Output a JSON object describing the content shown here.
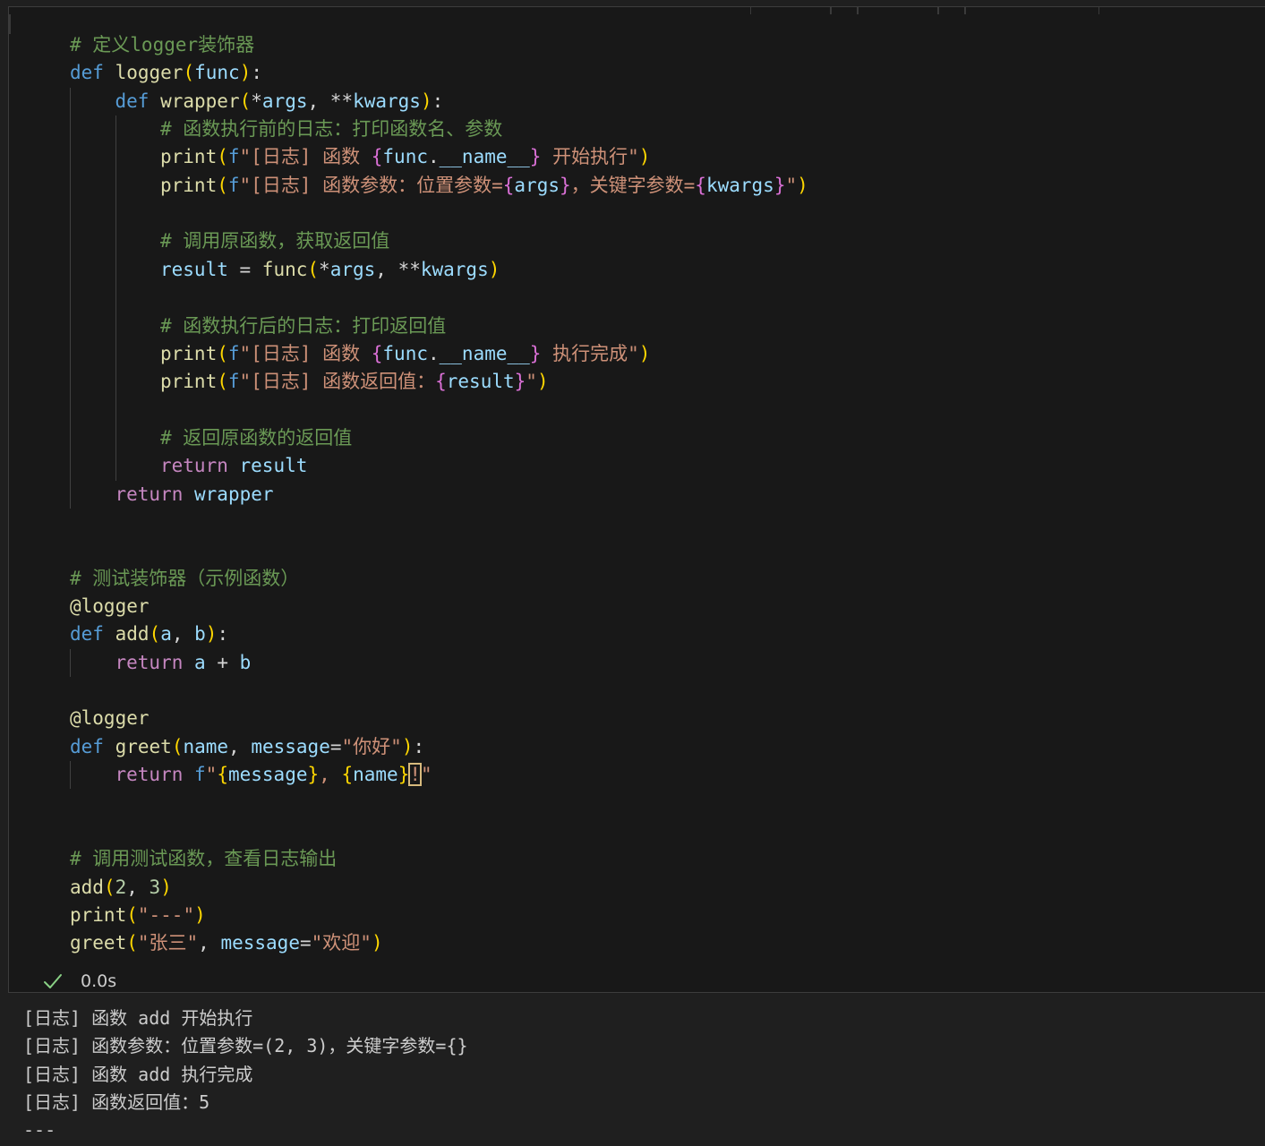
{
  "editor": {
    "lines": [
      {
        "indent": 0,
        "tokens": [
          {
            "t": "# 定义logger装饰器",
            "c": "c"
          }
        ]
      },
      {
        "indent": 0,
        "tokens": [
          {
            "t": "def",
            "c": "k"
          },
          {
            "t": " ",
            "c": "p"
          },
          {
            "t": "logger",
            "c": "f"
          },
          {
            "t": "(",
            "c": "b1"
          },
          {
            "t": "func",
            "c": "v"
          },
          {
            "t": ")",
            "c": "b1"
          },
          {
            "t": ":",
            "c": "p"
          }
        ]
      },
      {
        "indent": 1,
        "tokens": [
          {
            "t": "def",
            "c": "k"
          },
          {
            "t": " ",
            "c": "p"
          },
          {
            "t": "wrapper",
            "c": "f"
          },
          {
            "t": "(",
            "c": "b1"
          },
          {
            "t": "*",
            "c": "op"
          },
          {
            "t": "args",
            "c": "v"
          },
          {
            "t": ", ",
            "c": "p"
          },
          {
            "t": "**",
            "c": "op"
          },
          {
            "t": "kwargs",
            "c": "v"
          },
          {
            "t": ")",
            "c": "b1"
          },
          {
            "t": ":",
            "c": "p"
          }
        ]
      },
      {
        "indent": 2,
        "tokens": [
          {
            "t": "# 函数执行前的日志：打印函数名、参数",
            "c": "c"
          }
        ]
      },
      {
        "indent": 2,
        "tokens": [
          {
            "t": "print",
            "c": "f"
          },
          {
            "t": "(",
            "c": "b1"
          },
          {
            "t": "f",
            "c": "k"
          },
          {
            "t": "\"[日志] 函数 ",
            "c": "s"
          },
          {
            "t": "{",
            "c": "b2"
          },
          {
            "t": "func",
            "c": "v"
          },
          {
            "t": ".",
            "c": "p"
          },
          {
            "t": "__name__",
            "c": "v"
          },
          {
            "t": "}",
            "c": "b2"
          },
          {
            "t": " 开始执行\"",
            "c": "s"
          },
          {
            "t": ")",
            "c": "b1"
          }
        ]
      },
      {
        "indent": 2,
        "tokens": [
          {
            "t": "print",
            "c": "f"
          },
          {
            "t": "(",
            "c": "b1"
          },
          {
            "t": "f",
            "c": "k"
          },
          {
            "t": "\"[日志] 函数参数：位置参数=",
            "c": "s"
          },
          {
            "t": "{",
            "c": "b2"
          },
          {
            "t": "args",
            "c": "v"
          },
          {
            "t": "}",
            "c": "b2"
          },
          {
            "t": "，关键字参数=",
            "c": "s"
          },
          {
            "t": "{",
            "c": "b2"
          },
          {
            "t": "kwargs",
            "c": "v"
          },
          {
            "t": "}",
            "c": "b2"
          },
          {
            "t": "\"",
            "c": "s"
          },
          {
            "t": ")",
            "c": "b1"
          }
        ]
      },
      {
        "indent": 2,
        "tokens": []
      },
      {
        "indent": 2,
        "tokens": [
          {
            "t": "# 调用原函数，获取返回值",
            "c": "c"
          }
        ]
      },
      {
        "indent": 2,
        "tokens": [
          {
            "t": "result",
            "c": "v"
          },
          {
            "t": " = ",
            "c": "op"
          },
          {
            "t": "func",
            "c": "f"
          },
          {
            "t": "(",
            "c": "b1"
          },
          {
            "t": "*",
            "c": "op"
          },
          {
            "t": "args",
            "c": "v"
          },
          {
            "t": ", ",
            "c": "p"
          },
          {
            "t": "**",
            "c": "op"
          },
          {
            "t": "kwargs",
            "c": "v"
          },
          {
            "t": ")",
            "c": "b1"
          }
        ]
      },
      {
        "indent": 2,
        "tokens": []
      },
      {
        "indent": 2,
        "tokens": [
          {
            "t": "# 函数执行后的日志：打印返回值",
            "c": "c"
          }
        ]
      },
      {
        "indent": 2,
        "tokens": [
          {
            "t": "print",
            "c": "f"
          },
          {
            "t": "(",
            "c": "b1"
          },
          {
            "t": "f",
            "c": "k"
          },
          {
            "t": "\"[日志] 函数 ",
            "c": "s"
          },
          {
            "t": "{",
            "c": "b2"
          },
          {
            "t": "func",
            "c": "v"
          },
          {
            "t": ".",
            "c": "p"
          },
          {
            "t": "__name__",
            "c": "v"
          },
          {
            "t": "}",
            "c": "b2"
          },
          {
            "t": " 执行完成\"",
            "c": "s"
          },
          {
            "t": ")",
            "c": "b1"
          }
        ]
      },
      {
        "indent": 2,
        "tokens": [
          {
            "t": "print",
            "c": "f"
          },
          {
            "t": "(",
            "c": "b1"
          },
          {
            "t": "f",
            "c": "k"
          },
          {
            "t": "\"[日志] 函数返回值：",
            "c": "s"
          },
          {
            "t": "{",
            "c": "b2"
          },
          {
            "t": "result",
            "c": "v"
          },
          {
            "t": "}",
            "c": "b2"
          },
          {
            "t": "\"",
            "c": "s"
          },
          {
            "t": ")",
            "c": "b1"
          }
        ]
      },
      {
        "indent": 2,
        "tokens": []
      },
      {
        "indent": 2,
        "tokens": [
          {
            "t": "# 返回原函数的返回值",
            "c": "c"
          }
        ]
      },
      {
        "indent": 2,
        "tokens": [
          {
            "t": "return",
            "c": "r"
          },
          {
            "t": " ",
            "c": "p"
          },
          {
            "t": "result",
            "c": "v"
          }
        ]
      },
      {
        "indent": 1,
        "tokens": [
          {
            "t": "return",
            "c": "r"
          },
          {
            "t": " ",
            "c": "p"
          },
          {
            "t": "wrapper",
            "c": "v"
          }
        ]
      },
      {
        "indent": 0,
        "tokens": []
      },
      {
        "indent": 0,
        "tokens": []
      },
      {
        "indent": 0,
        "tokens": [
          {
            "t": "# 测试装饰器（示例函数）",
            "c": "c"
          }
        ]
      },
      {
        "indent": 0,
        "tokens": [
          {
            "t": "@logger",
            "c": "d"
          }
        ]
      },
      {
        "indent": 0,
        "tokens": [
          {
            "t": "def",
            "c": "k"
          },
          {
            "t": " ",
            "c": "p"
          },
          {
            "t": "add",
            "c": "f"
          },
          {
            "t": "(",
            "c": "b1"
          },
          {
            "t": "a",
            "c": "v"
          },
          {
            "t": ", ",
            "c": "p"
          },
          {
            "t": "b",
            "c": "v"
          },
          {
            "t": ")",
            "c": "b1"
          },
          {
            "t": ":",
            "c": "p"
          }
        ]
      },
      {
        "indent": 1,
        "tokens": [
          {
            "t": "return",
            "c": "r"
          },
          {
            "t": " ",
            "c": "p"
          },
          {
            "t": "a",
            "c": "v"
          },
          {
            "t": " + ",
            "c": "op"
          },
          {
            "t": "b",
            "c": "v"
          }
        ]
      },
      {
        "indent": 0,
        "tokens": []
      },
      {
        "indent": 0,
        "tokens": [
          {
            "t": "@logger",
            "c": "d"
          }
        ]
      },
      {
        "indent": 0,
        "tokens": [
          {
            "t": "def",
            "c": "k"
          },
          {
            "t": " ",
            "c": "p"
          },
          {
            "t": "greet",
            "c": "f"
          },
          {
            "t": "(",
            "c": "b1"
          },
          {
            "t": "name",
            "c": "v"
          },
          {
            "t": ", ",
            "c": "p"
          },
          {
            "t": "message",
            "c": "v"
          },
          {
            "t": "=",
            "c": "op"
          },
          {
            "t": "\"你好\"",
            "c": "s"
          },
          {
            "t": ")",
            "c": "b1"
          },
          {
            "t": ":",
            "c": "p"
          }
        ]
      },
      {
        "indent": 1,
        "tokens": [
          {
            "t": "return",
            "c": "r"
          },
          {
            "t": " ",
            "c": "p"
          },
          {
            "t": "f",
            "c": "k"
          },
          {
            "t": "\"",
            "c": "s"
          },
          {
            "t": "{",
            "c": "b1"
          },
          {
            "t": "message",
            "c": "v"
          },
          {
            "t": "}",
            "c": "b1"
          },
          {
            "t": ", ",
            "c": "s"
          },
          {
            "t": "{",
            "c": "b1"
          },
          {
            "t": "name",
            "c": "v"
          },
          {
            "t": "}",
            "c": "b1"
          },
          {
            "t": "!",
            "c": "cur"
          },
          {
            "t": "\"",
            "c": "s"
          }
        ]
      },
      {
        "indent": 0,
        "tokens": []
      },
      {
        "indent": 0,
        "tokens": []
      },
      {
        "indent": 0,
        "tokens": [
          {
            "t": "# 调用测试函数，查看日志输出",
            "c": "c"
          }
        ]
      },
      {
        "indent": 0,
        "tokens": [
          {
            "t": "add",
            "c": "f"
          },
          {
            "t": "(",
            "c": "b1"
          },
          {
            "t": "2",
            "c": "n"
          },
          {
            "t": ", ",
            "c": "p"
          },
          {
            "t": "3",
            "c": "n"
          },
          {
            "t": ")",
            "c": "b1"
          }
        ]
      },
      {
        "indent": 0,
        "tokens": [
          {
            "t": "print",
            "c": "f"
          },
          {
            "t": "(",
            "c": "b1"
          },
          {
            "t": "\"---\"",
            "c": "s"
          },
          {
            "t": ")",
            "c": "b1"
          }
        ]
      },
      {
        "indent": 0,
        "tokens": [
          {
            "t": "greet",
            "c": "f"
          },
          {
            "t": "(",
            "c": "b1"
          },
          {
            "t": "\"张三\"",
            "c": "s"
          },
          {
            "t": ", ",
            "c": "p"
          },
          {
            "t": "message",
            "c": "v"
          },
          {
            "t": "=",
            "c": "op"
          },
          {
            "t": "\"欢迎\"",
            "c": "s"
          },
          {
            "t": ")",
            "c": "b1"
          }
        ]
      }
    ]
  },
  "status": {
    "icon": "check-icon",
    "exec_time": "0.0s",
    "check_color": "#89d185"
  },
  "output": {
    "lines": [
      "[日志] 函数 add 开始执行",
      "[日志] 函数参数：位置参数=(2, 3)，关键字参数={}",
      "[日志] 函数 add 执行完成",
      "[日志] 函数返回值：5",
      "---"
    ]
  },
  "colors": {
    "background": "#1f1f1f",
    "cell_background": "#181818",
    "keyword": "#569cd6",
    "function": "#dcdcaa",
    "variable": "#9cdcfe",
    "string": "#ce9178",
    "comment": "#6a9955",
    "control": "#c586c0"
  }
}
